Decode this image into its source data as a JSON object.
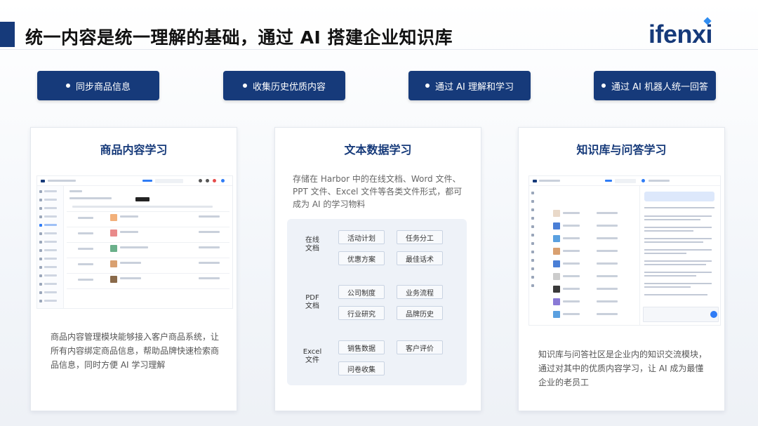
{
  "header": {
    "title": "统一内容是统一理解的基础，通过 AI 搭建企业知识库",
    "logo": "ifenxi"
  },
  "steps": [
    {
      "label": "同步商品信息"
    },
    {
      "label": "收集历史优质内容"
    },
    {
      "label": "通过 AI 理解和学习"
    },
    {
      "label": "通过 AI 机器人统一回答"
    }
  ],
  "cards": {
    "product": {
      "title": "商品内容学习",
      "desc": "商品内容管理模块能够接入客户商品系统，让所有内容绑定商品信息，帮助品牌快速检索商品信息，同时方便 AI 学习理解"
    },
    "text": {
      "title": "文本数据学习",
      "intro": "存储在 Harbor 中的在线文档、Word 文件、PPT 文件、Excel 文件等各类文件形式，都可成为 AI 的学习物料",
      "groups": [
        {
          "label": "在线\n文档",
          "items": [
            "活动计划",
            "任务分工",
            "优惠方案",
            "最佳话术"
          ]
        },
        {
          "label": "PDF\n文档",
          "items": [
            "公司制度",
            "业务流程",
            "行业研究",
            "品牌历史"
          ]
        },
        {
          "label": "Excel\n文件",
          "items": [
            "销售数据",
            "客户评价",
            "问卷收集"
          ]
        }
      ]
    },
    "qa": {
      "title": "知识库与问答学习",
      "desc": "知识库与问答社区是企业内的知识交流模块，通过对其中的优质内容学习，让 AI 成为最懂企业的老员工"
    }
  },
  "colors": {
    "primary": "#163a7a",
    "accent": "#2f8cf0"
  }
}
